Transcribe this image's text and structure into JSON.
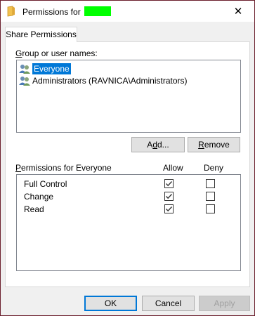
{
  "window": {
    "title": "Permissions for",
    "close_glyph": "✕"
  },
  "tab": {
    "label": "Share Permissions"
  },
  "group": {
    "label_prefix": "G",
    "label_rest": "roup or user names:",
    "users": [
      {
        "name": "Everyone",
        "icon": "user-group-icon",
        "selected": true
      },
      {
        "name": "Administrators (RAVNICA\\Administrators)",
        "icon": "user-group-icon",
        "selected": false
      }
    ]
  },
  "buttons": {
    "add_pre": "A",
    "add_u": "d",
    "add_post": "d...",
    "remove_u": "R",
    "remove_post": "emove"
  },
  "permissions": {
    "header_u": "P",
    "header_rest": "ermissions for Everyone",
    "allow_label": "Allow",
    "deny_label": "Deny",
    "rows": [
      {
        "name": "Full Control",
        "allow": true,
        "deny": false
      },
      {
        "name": "Change",
        "allow": true,
        "deny": false
      },
      {
        "name": "Read",
        "allow": true,
        "deny": false
      }
    ]
  },
  "footer": {
    "ok_label": "OK",
    "cancel_label": "Cancel",
    "apply_label": "Apply"
  },
  "colors": {
    "accent": "#0078d7",
    "redaction": "#00ff00",
    "frame": "#6b1f2c"
  }
}
